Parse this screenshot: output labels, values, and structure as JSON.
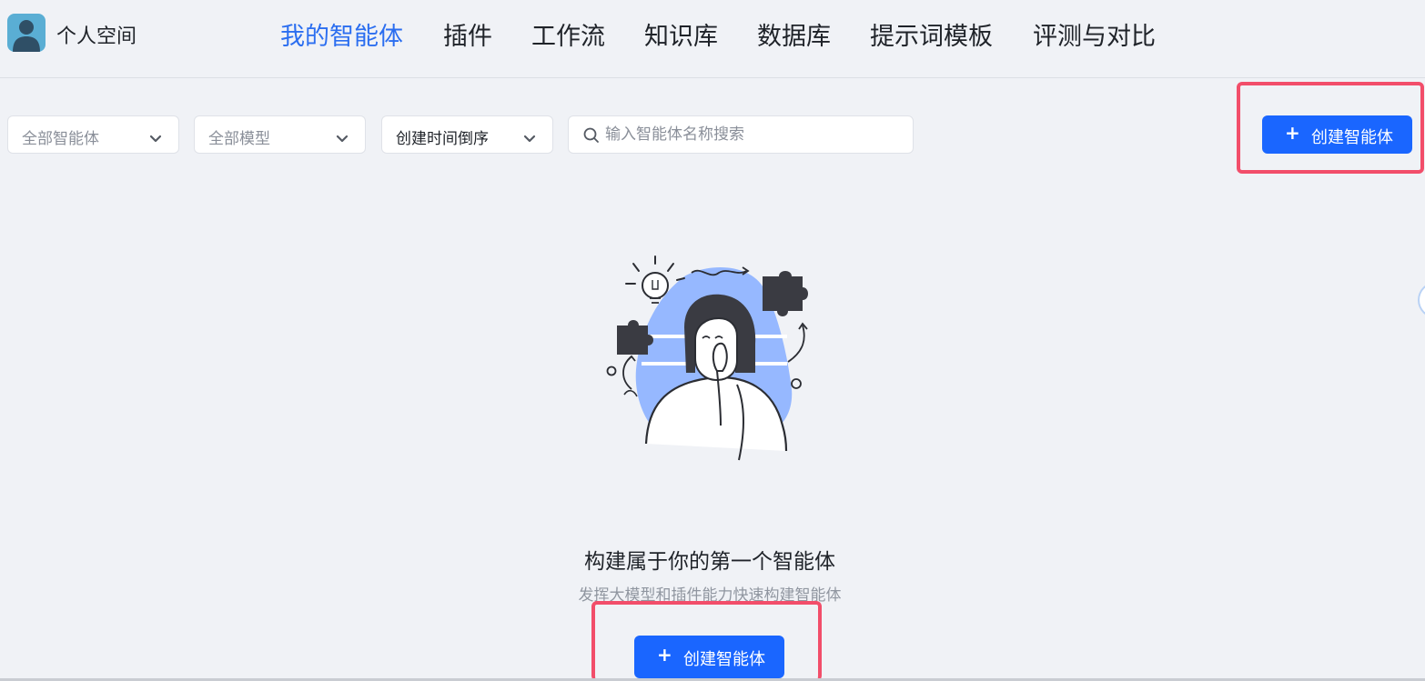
{
  "header": {
    "space_title": "个人空间",
    "avatar_icon": "user-avatar-icon",
    "tabs": [
      {
        "label": "我的智能体",
        "active": true
      },
      {
        "label": "插件",
        "active": false
      },
      {
        "label": "工作流",
        "active": false
      },
      {
        "label": "知识库",
        "active": false
      },
      {
        "label": "数据库",
        "active": false
      },
      {
        "label": "提示词模板",
        "active": false
      },
      {
        "label": "评测与对比",
        "active": false
      }
    ]
  },
  "filters": {
    "agent_type": "全部智能体",
    "model": "全部模型",
    "sort": "创建时间倒序",
    "search_placeholder": "输入智能体名称搜索"
  },
  "actions": {
    "create_label": "创建智能体",
    "plus": "+"
  },
  "empty_state": {
    "title": "构建属于你的第一个智能体",
    "subtitle": "发挥大模型和插件能力快速构建智能体",
    "create_label": "创建智能体",
    "plus": "+"
  },
  "colors": {
    "accent": "#1a66ff",
    "active_tab": "#2b6ef0",
    "highlight": "#f24e6a",
    "background": "#f0f2f6"
  }
}
